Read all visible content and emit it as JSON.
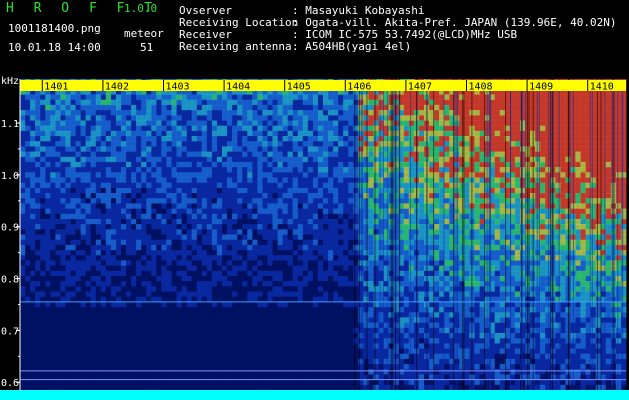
{
  "header": {
    "app_title": "H R O F F T",
    "app_version": "1.0.0",
    "filename": "1001181400.png",
    "datetime": "10.01.18 14:00",
    "counter_label": "meteor",
    "counter_value": "51",
    "info": [
      {
        "label": "Ovserver",
        "value": "Masayuki Kobayashi"
      },
      {
        "label": "Receiving Location",
        "value": "Ogata-vill. Akita-Pref. JAPAN (139.96E, 40.02N)"
      },
      {
        "label": "Receiver",
        "value": "ICOM IC-575 53.7492(@LCD)MHz USB"
      },
      {
        "label": "Receiving antenna",
        "value": "A504HB(yagi 4el)"
      }
    ]
  },
  "chart_data": {
    "type": "heatmap",
    "ylabel": "kHz",
    "x_ticks": [
      "1401",
      "1402",
      "1403",
      "1404",
      "1405",
      "1406",
      "1407",
      "1408",
      "1409",
      "1410"
    ],
    "y_ticks": [
      "1.1",
      "1.0",
      "0.9",
      "0.8",
      "0.7",
      "0.6"
    ],
    "y_tick_values": [
      1.1,
      1.0,
      0.9,
      0.8,
      0.7,
      0.6
    ],
    "ylim": [
      0.585,
      1.185
    ],
    "xlim": [
      1400.5,
      1410.5
    ],
    "colors": {
      "background": "#000000",
      "low": "#00106a",
      "mid": "#1a8ce0",
      "high": "#30d060",
      "peak": "#e04020",
      "axis": "#ffffff",
      "label_bar": "#ffff00",
      "bottom_bar": "#00ffff"
    },
    "horizontal_lines_khz": [
      0.755,
      0.622,
      0.605
    ],
    "bright_region_start_minute": 1406
  }
}
